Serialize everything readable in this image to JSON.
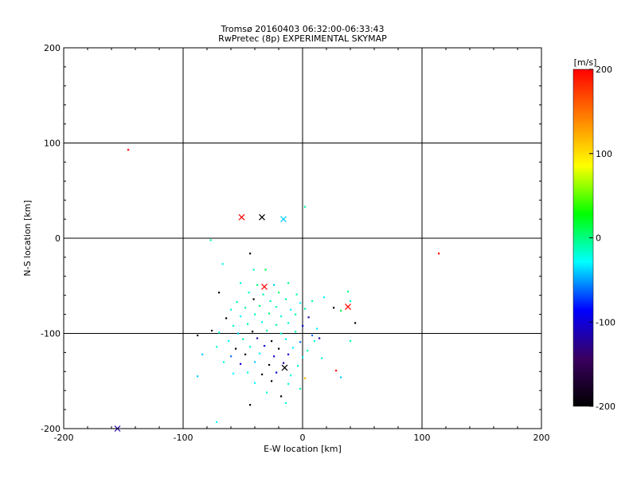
{
  "chart_data": {
    "type": "scatter",
    "title": "Tromsø 20160403 06:32:00-06:33:43",
    "subtitle": "RwPretec (8p) EXPERIMENTAL SKYMAP",
    "xlabel": "E-W location [km]",
    "ylabel": "N-S location [km]",
    "xlim": [
      -200,
      200
    ],
    "ylim": [
      -200,
      200
    ],
    "x_ticks": [
      -200,
      -100,
      0,
      100,
      200
    ],
    "y_ticks": [
      -200,
      -100,
      0,
      100,
      200
    ],
    "x_tick_labels": [
      "-200",
      "-100",
      "0",
      "100",
      "200"
    ],
    "y_tick_labels": [
      "-200",
      "-100",
      "0",
      "100",
      "200"
    ],
    "grid": true,
    "colorbar": {
      "label": "[m/s]",
      "range": [
        -200,
        200
      ],
      "ticks": [
        -200,
        -100,
        0,
        100,
        200
      ],
      "tick_labels": [
        "-200",
        "-100",
        "0",
        "100",
        "200"
      ],
      "colors": [
        "#000000",
        "#3a0060",
        "#0000ff",
        "#00ffff",
        "#00ff00",
        "#ffff00",
        "#ff8000",
        "#ff0000"
      ]
    },
    "cross_markers": [
      {
        "x": -51,
        "y": 22,
        "v": 200
      },
      {
        "x": -34,
        "y": 22,
        "v": -200
      },
      {
        "x": -16,
        "y": 20,
        "v": -40
      },
      {
        "x": -32,
        "y": -51,
        "v": 200
      },
      {
        "x": 38,
        "y": -72,
        "v": 200
      },
      {
        "x": -15,
        "y": -136,
        "v": -200
      },
      {
        "x": -155,
        "y": -200,
        "v": -120
      }
    ],
    "points": [
      {
        "x": -146,
        "y": 93,
        "v": 200
      },
      {
        "x": 114,
        "y": -16,
        "v": 200
      },
      {
        "x": 2,
        "y": 33,
        "v": -10
      },
      {
        "x": -77,
        "y": -2,
        "v": -5
      },
      {
        "x": -44,
        "y": -16,
        "v": -200
      },
      {
        "x": -67,
        "y": -27,
        "v": -20
      },
      {
        "x": -41,
        "y": -33,
        "v": -20
      },
      {
        "x": -31,
        "y": -33,
        "v": 10
      },
      {
        "x": -70,
        "y": -57,
        "v": -200
      },
      {
        "x": -52,
        "y": -47,
        "v": -20
      },
      {
        "x": -38,
        "y": -49,
        "v": 0
      },
      {
        "x": -24,
        "y": -49,
        "v": -40
      },
      {
        "x": -12,
        "y": -47,
        "v": 0
      },
      {
        "x": -45,
        "y": -57,
        "v": -15
      },
      {
        "x": -33,
        "y": -59,
        "v": -10
      },
      {
        "x": -20,
        "y": -57,
        "v": 5
      },
      {
        "x": -5,
        "y": -59,
        "v": -10
      },
      {
        "x": 38,
        "y": -56,
        "v": -5
      },
      {
        "x": 18,
        "y": -62,
        "v": -30
      },
      {
        "x": -55,
        "y": -67,
        "v": -10
      },
      {
        "x": -41,
        "y": -64,
        "v": -200
      },
      {
        "x": -27,
        "y": -66,
        "v": -15
      },
      {
        "x": -14,
        "y": -64,
        "v": -5
      },
      {
        "x": -2,
        "y": -68,
        "v": -30
      },
      {
        "x": 8,
        "y": -66,
        "v": -10
      },
      {
        "x": 26,
        "y": -73,
        "v": -200
      },
      {
        "x": 32,
        "y": -76,
        "v": 10
      },
      {
        "x": 40,
        "y": -66,
        "v": -20
      },
      {
        "x": -60,
        "y": -75,
        "v": -20
      },
      {
        "x": -48,
        "y": -73,
        "v": -10
      },
      {
        "x": -36,
        "y": -71,
        "v": 0
      },
      {
        "x": -22,
        "y": -72,
        "v": -15
      },
      {
        "x": -10,
        "y": -75,
        "v": -30
      },
      {
        "x": 2,
        "y": -74,
        "v": -10
      },
      {
        "x": -64,
        "y": -84,
        "v": -200
      },
      {
        "x": -52,
        "y": -82,
        "v": -30
      },
      {
        "x": -40,
        "y": -80,
        "v": -15
      },
      {
        "x": -28,
        "y": -79,
        "v": 0
      },
      {
        "x": -18,
        "y": -82,
        "v": -20
      },
      {
        "x": -6,
        "y": -80,
        "v": -10
      },
      {
        "x": 5,
        "y": -83,
        "v": -120
      },
      {
        "x": 44,
        "y": -89,
        "v": -200
      },
      {
        "x": -58,
        "y": -92,
        "v": -15
      },
      {
        "x": -46,
        "y": -90,
        "v": -10
      },
      {
        "x": -34,
        "y": -88,
        "v": -30
      },
      {
        "x": -22,
        "y": -91,
        "v": -5
      },
      {
        "x": -12,
        "y": -89,
        "v": -20
      },
      {
        "x": 0,
        "y": -92,
        "v": -100
      },
      {
        "x": 12,
        "y": -95,
        "v": -30
      },
      {
        "x": -76,
        "y": -97,
        "v": -200
      },
      {
        "x": -70,
        "y": -99,
        "v": -20
      },
      {
        "x": -54,
        "y": -100,
        "v": -40
      },
      {
        "x": -42,
        "y": -98,
        "v": -200
      },
      {
        "x": -30,
        "y": -97,
        "v": -10
      },
      {
        "x": -18,
        "y": -100,
        "v": -20
      },
      {
        "x": -6,
        "y": -98,
        "v": -15
      },
      {
        "x": 8,
        "y": -102,
        "v": -60
      },
      {
        "x": 14,
        "y": -105,
        "v": -120
      },
      {
        "x": -88,
        "y": -102,
        "v": -200
      },
      {
        "x": -62,
        "y": -108,
        "v": -30
      },
      {
        "x": -50,
        "y": -106,
        "v": -10
      },
      {
        "x": -38,
        "y": -105,
        "v": -120
      },
      {
        "x": -26,
        "y": -108,
        "v": -200
      },
      {
        "x": -14,
        "y": -106,
        "v": -30
      },
      {
        "x": -2,
        "y": -109,
        "v": -60
      },
      {
        "x": 10,
        "y": -108,
        "v": -20
      },
      {
        "x": 40,
        "y": -108,
        "v": -10
      },
      {
        "x": -72,
        "y": -114,
        "v": -20
      },
      {
        "x": -56,
        "y": -116,
        "v": -200
      },
      {
        "x": -44,
        "y": -114,
        "v": -20
      },
      {
        "x": -32,
        "y": -113,
        "v": -100
      },
      {
        "x": -20,
        "y": -116,
        "v": -200
      },
      {
        "x": -8,
        "y": -115,
        "v": -30
      },
      {
        "x": 4,
        "y": -118,
        "v": -10
      },
      {
        "x": -84,
        "y": -122,
        "v": -40
      },
      {
        "x": -60,
        "y": -124,
        "v": -60
      },
      {
        "x": -48,
        "y": -122,
        "v": -200
      },
      {
        "x": -36,
        "y": -121,
        "v": -30
      },
      {
        "x": -24,
        "y": -124,
        "v": -110
      },
      {
        "x": -12,
        "y": -122,
        "v": -100
      },
      {
        "x": 0,
        "y": -125,
        "v": -30
      },
      {
        "x": 16,
        "y": -126,
        "v": -20
      },
      {
        "x": -66,
        "y": -130,
        "v": -20
      },
      {
        "x": -52,
        "y": -132,
        "v": -100
      },
      {
        "x": -40,
        "y": -130,
        "v": -40
      },
      {
        "x": -28,
        "y": -133,
        "v": -200
      },
      {
        "x": -16,
        "y": -131,
        "v": -120
      },
      {
        "x": -4,
        "y": -134,
        "v": -20
      },
      {
        "x": 28,
        "y": -139,
        "v": 200
      },
      {
        "x": 32,
        "y": -146,
        "v": -40
      },
      {
        "x": -88,
        "y": -145,
        "v": -40
      },
      {
        "x": -58,
        "y": -142,
        "v": -30
      },
      {
        "x": -46,
        "y": -141,
        "v": -20
      },
      {
        "x": -34,
        "y": -143,
        "v": -200
      },
      {
        "x": -22,
        "y": -141,
        "v": -100
      },
      {
        "x": -10,
        "y": -144,
        "v": -20
      },
      {
        "x": 2,
        "y": -147,
        "v": 120
      },
      {
        "x": -40,
        "y": -152,
        "v": -30
      },
      {
        "x": -26,
        "y": -150,
        "v": -200
      },
      {
        "x": -12,
        "y": -153,
        "v": -20
      },
      {
        "x": -2,
        "y": -158,
        "v": -10
      },
      {
        "x": -30,
        "y": -162,
        "v": -20
      },
      {
        "x": -18,
        "y": -166,
        "v": -200
      },
      {
        "x": -44,
        "y": -175,
        "v": -200
      },
      {
        "x": -14,
        "y": -173,
        "v": -20
      },
      {
        "x": -72,
        "y": -193,
        "v": -30
      }
    ]
  }
}
